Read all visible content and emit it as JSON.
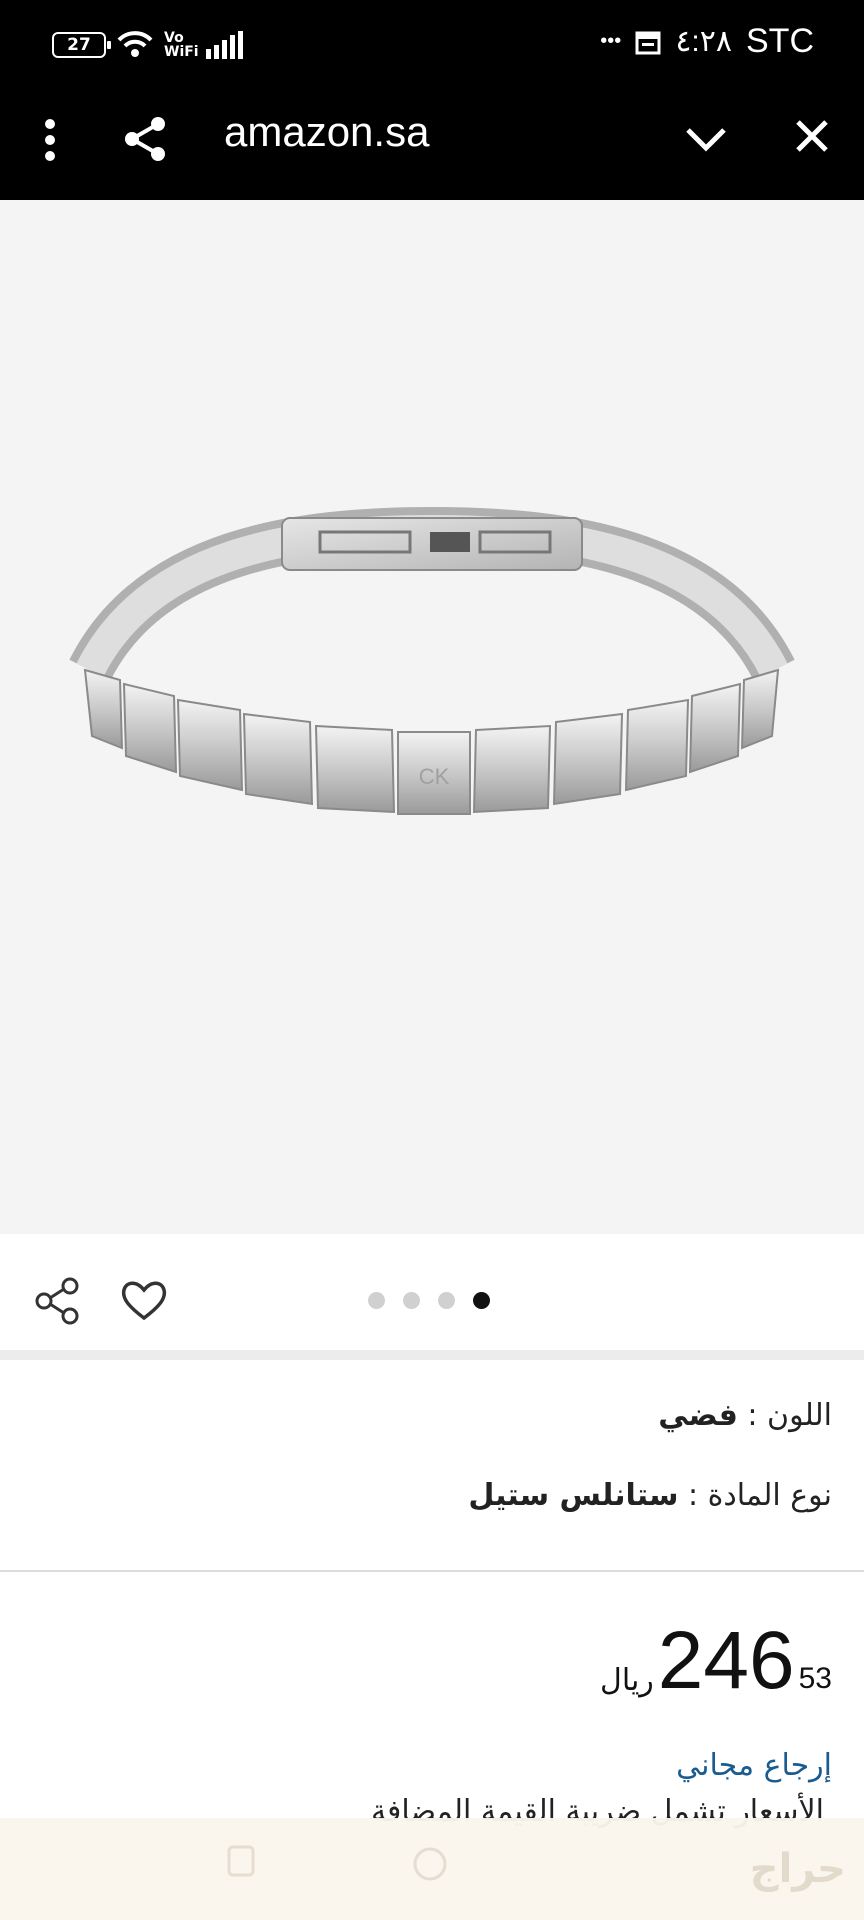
{
  "status_bar": {
    "battery": "27",
    "vowifi": "Vo WiFi",
    "time": "٤:٢٨",
    "carrier": "STC",
    "more": "•••"
  },
  "browser": {
    "url": "amazon.sa",
    "icons": [
      "more-vert-icon",
      "share-icon",
      "chevron-down-icon",
      "close-icon"
    ]
  },
  "product": {
    "image_logo": "CK",
    "carousel_total": 4,
    "carousel_active": 4,
    "attributes": {
      "color_label": "اللون :",
      "color_value": "فضي",
      "material_label": "نوع المادة :",
      "material_value": "ستانلس ستيل"
    },
    "price": {
      "whole": "246",
      "fraction": "53",
      "currency": "ريال"
    },
    "returns": "إرجاع مجاني",
    "vat_note": "الأسعار تشمل ضريبة القيمة المضافة"
  },
  "watermark": "حراج"
}
